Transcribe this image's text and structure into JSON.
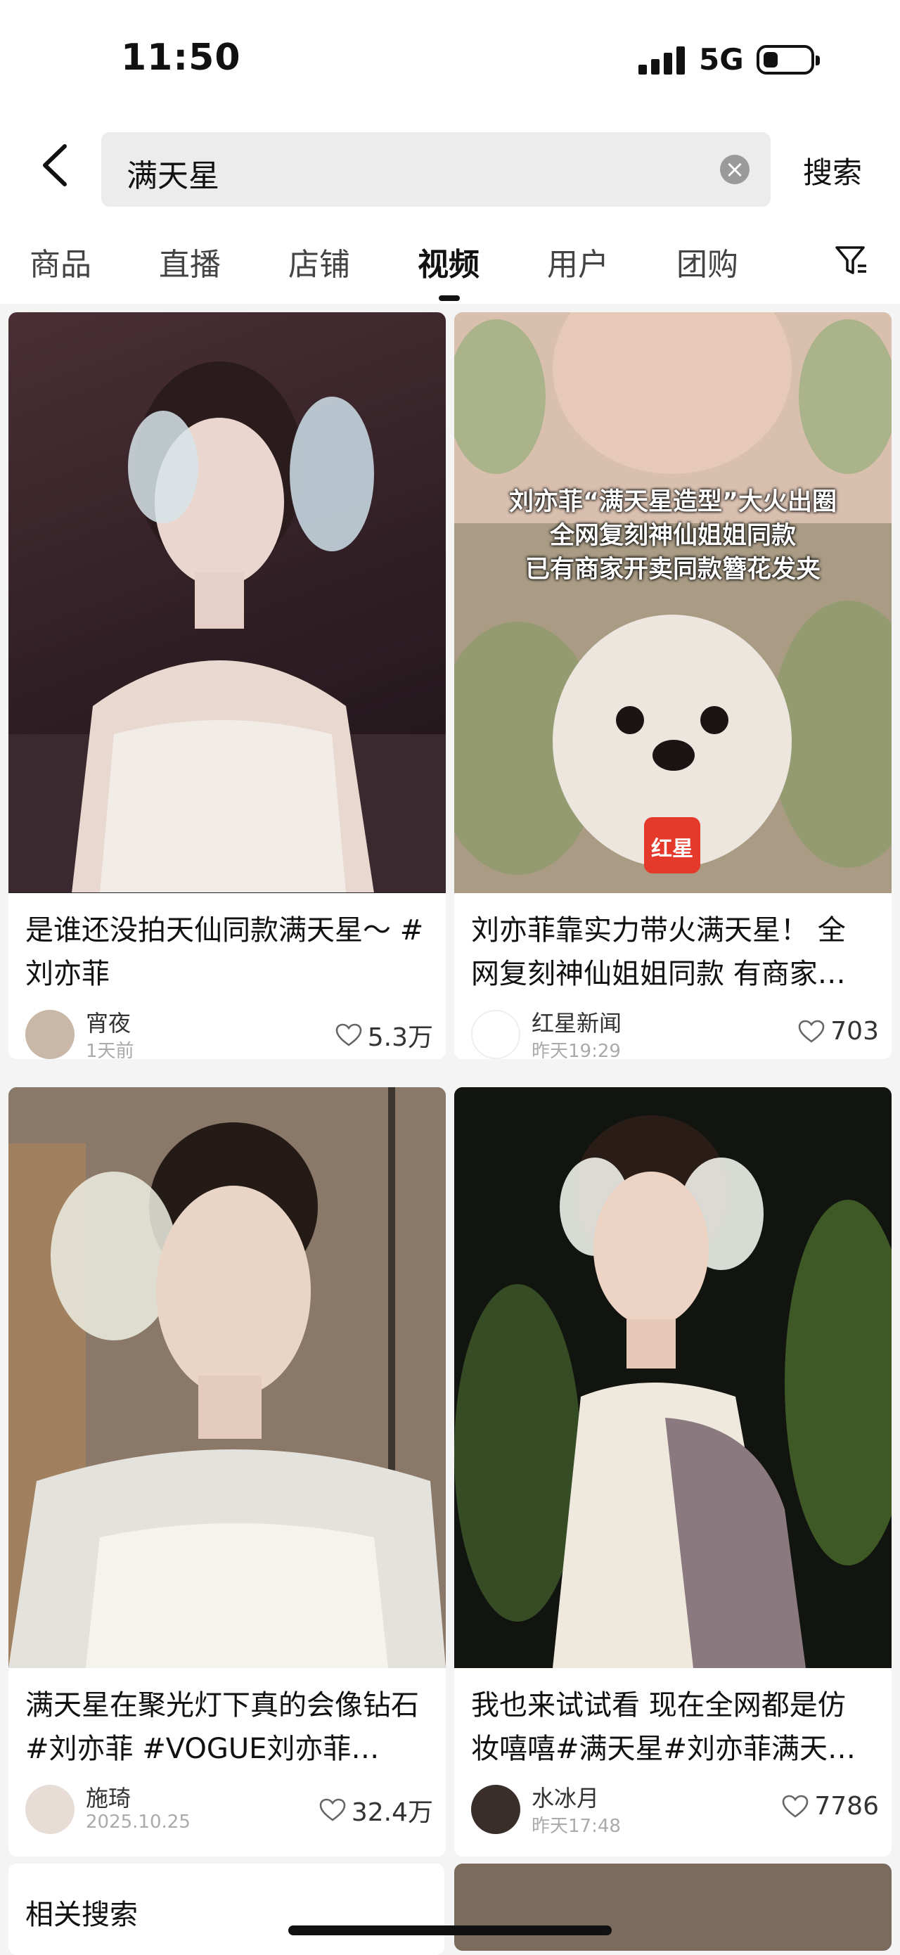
{
  "status": {
    "time": "11:50",
    "network": "5G"
  },
  "search": {
    "query": "满天星",
    "button": "搜索"
  },
  "tabs": [
    {
      "label": "商品",
      "active": false
    },
    {
      "label": "直播",
      "active": false
    },
    {
      "label": "店铺",
      "active": false
    },
    {
      "label": "视频",
      "active": true
    },
    {
      "label": "用户",
      "active": false
    },
    {
      "label": "团购",
      "active": false
    }
  ],
  "cards": [
    {
      "title": "是谁还没拍天仙同款满天星～ #刘亦菲",
      "author": "宵夜",
      "date": "1天前",
      "likes": "5.3万"
    },
    {
      "title": "刘亦菲靠实力带火满天星！ 全网复刻神仙姐姐同款  有商家…",
      "author": "红星新闻",
      "date": "昨天19:29",
      "likes": "703",
      "overlay": [
        "刘亦菲“满天星造型”大火出圈",
        "全网复刻神仙姐姐同款",
        "已有商家开卖同款簪花发夹"
      ],
      "badge": "红星"
    },
    {
      "title": "满天星在聚光灯下真的会像钻石 #刘亦菲 #VOGUE刘亦菲…",
      "author": "施琦",
      "date": "2025.10.25",
      "likes": "32.4万"
    },
    {
      "title": "我也来试试看 现在全网都是仿妆嘻嘻#满天星#刘亦菲满天…",
      "author": "水冰月",
      "date": "昨天17:48",
      "likes": "7786"
    }
  ],
  "related": {
    "label": "相关搜索"
  },
  "colors": {
    "badge_red": "#e53a2b",
    "tab_active": "#111111"
  }
}
